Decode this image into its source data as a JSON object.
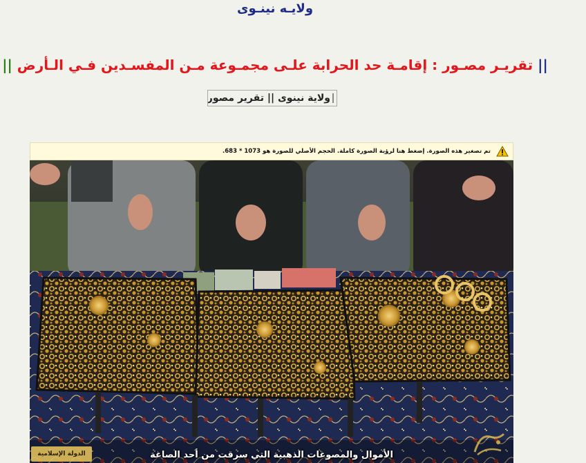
{
  "header": {
    "site_title": "ولايـه نينـوى"
  },
  "article": {
    "bars_left": "||",
    "bars_right": "||",
    "headline": "تقريـر مصـور : إقامـة حد الحرابة علـى مجمـوعة مـن المفسـدين فـي الـأرض",
    "image_alt": "ولاية نينوى || تقرير مصور"
  },
  "image_notice": {
    "text": "تم تصغير هذه الصورة. إضغط هنا لرؤية الصورة كاملة. الحجم الأصلي للصورة هو 1073 * 683.",
    "icon": "warning-icon"
  },
  "photo": {
    "caption": "الأموال والمصوغات الذهبية التي سرقت من أحد الصاغة",
    "logo_left_text": "الدولة الإسلامية",
    "logo_right_icon": "watermark-logo"
  },
  "colors": {
    "page_bg": "#f1f2ec",
    "title_blue": "#1e2b86",
    "headline_red": "#e3161b",
    "bars_green": "#2e7d1c",
    "notice_bg": "#fffadc"
  }
}
